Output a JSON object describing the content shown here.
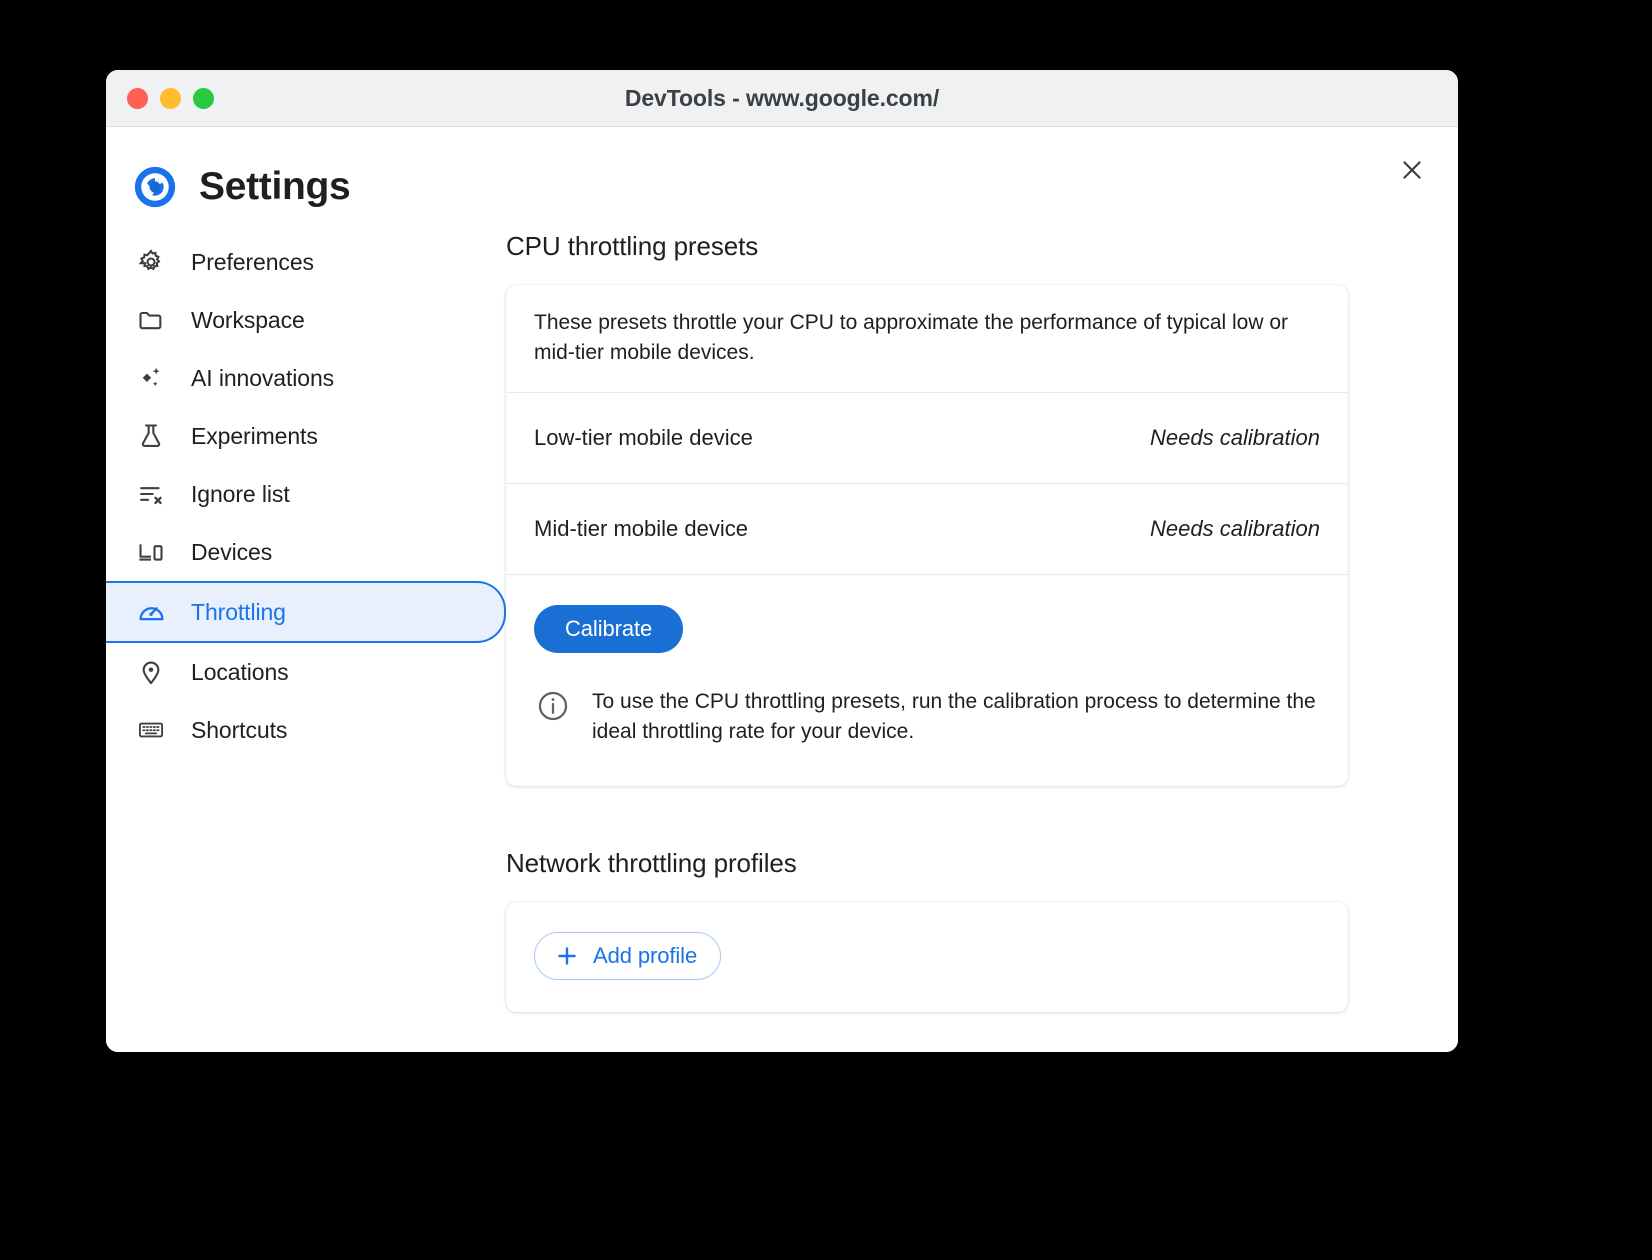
{
  "window": {
    "title": "DevTools - www.google.com/",
    "traffic_lights": [
      "close",
      "minimize",
      "maximize"
    ]
  },
  "header": {
    "title": "Settings",
    "logo_icon": "chrome-logo-icon",
    "close_icon": "close-icon"
  },
  "sidebar": {
    "items": [
      {
        "label": "Preferences",
        "icon": "gear-icon",
        "selected": false
      },
      {
        "label": "Workspace",
        "icon": "folder-icon",
        "selected": false
      },
      {
        "label": "AI innovations",
        "icon": "sparkle-icon",
        "selected": false
      },
      {
        "label": "Experiments",
        "icon": "flask-icon",
        "selected": false
      },
      {
        "label": "Ignore list",
        "icon": "list-x-icon",
        "selected": false
      },
      {
        "label": "Devices",
        "icon": "devices-icon",
        "selected": false
      },
      {
        "label": "Throttling",
        "icon": "speedometer-icon",
        "selected": true
      },
      {
        "label": "Locations",
        "icon": "location-pin-icon",
        "selected": false
      },
      {
        "label": "Shortcuts",
        "icon": "keyboard-icon",
        "selected": false
      }
    ]
  },
  "cpu_section": {
    "title": "CPU throttling presets",
    "description": "These presets throttle your CPU to approximate the performance of typical low or mid-tier mobile devices.",
    "presets": [
      {
        "name": "Low-tier mobile device",
        "status": "Needs calibration"
      },
      {
        "name": "Mid-tier mobile device",
        "status": "Needs calibration"
      }
    ],
    "calibrate_label": "Calibrate",
    "info_icon": "info-icon",
    "info_text": "To use the CPU throttling presets, run the calibration process to determine the ideal throttling rate for your device."
  },
  "network_section": {
    "title": "Network throttling profiles",
    "add_profile_label": "Add profile",
    "add_icon": "plus-icon"
  },
  "colors": {
    "accent": "#1a73e8",
    "primary_button": "#1a6fd4",
    "selected_bg": "#e8f0fe",
    "titlebar_bg": "#eff1f3",
    "text": "#1f1f1f"
  }
}
